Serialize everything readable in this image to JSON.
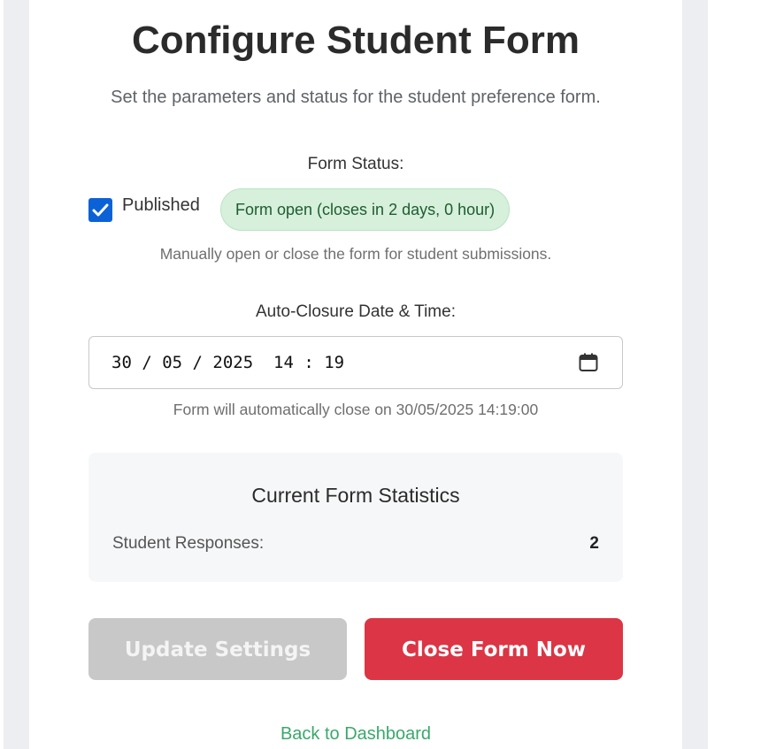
{
  "page": {
    "title": "Configure Student Form",
    "subtitle": "Set the parameters and status for the student preference form."
  },
  "form_status": {
    "label": "Form Status:",
    "checkbox_label": "Published",
    "checked": true,
    "badge": "Form open (closes in 2 days, 0 hour)",
    "help": "Manually open or close the form for student submissions."
  },
  "auto_closure": {
    "label": "Auto-Closure Date & Time:",
    "value": "30 / 05 / 2025  14 : 19",
    "help": "Form will automatically close on 30/05/2025 14:19:00"
  },
  "stats": {
    "title": "Current Form Statistics",
    "responses_label": "Student Responses:",
    "responses_value": "2"
  },
  "actions": {
    "update_label": "Update Settings",
    "close_label": "Close Form Now",
    "back_label": "Back to Dashboard"
  },
  "colors": {
    "checkbox": "#0b62d6",
    "badge_bg": "#d6f0dc",
    "badge_text": "#1f5c2e",
    "update_button_disabled": "#c8c8c8",
    "close_button": "#dc3545",
    "link": "#3aa86b"
  },
  "icons": {
    "checkbox": "checkmark-icon",
    "datetime": "calendar-icon"
  }
}
